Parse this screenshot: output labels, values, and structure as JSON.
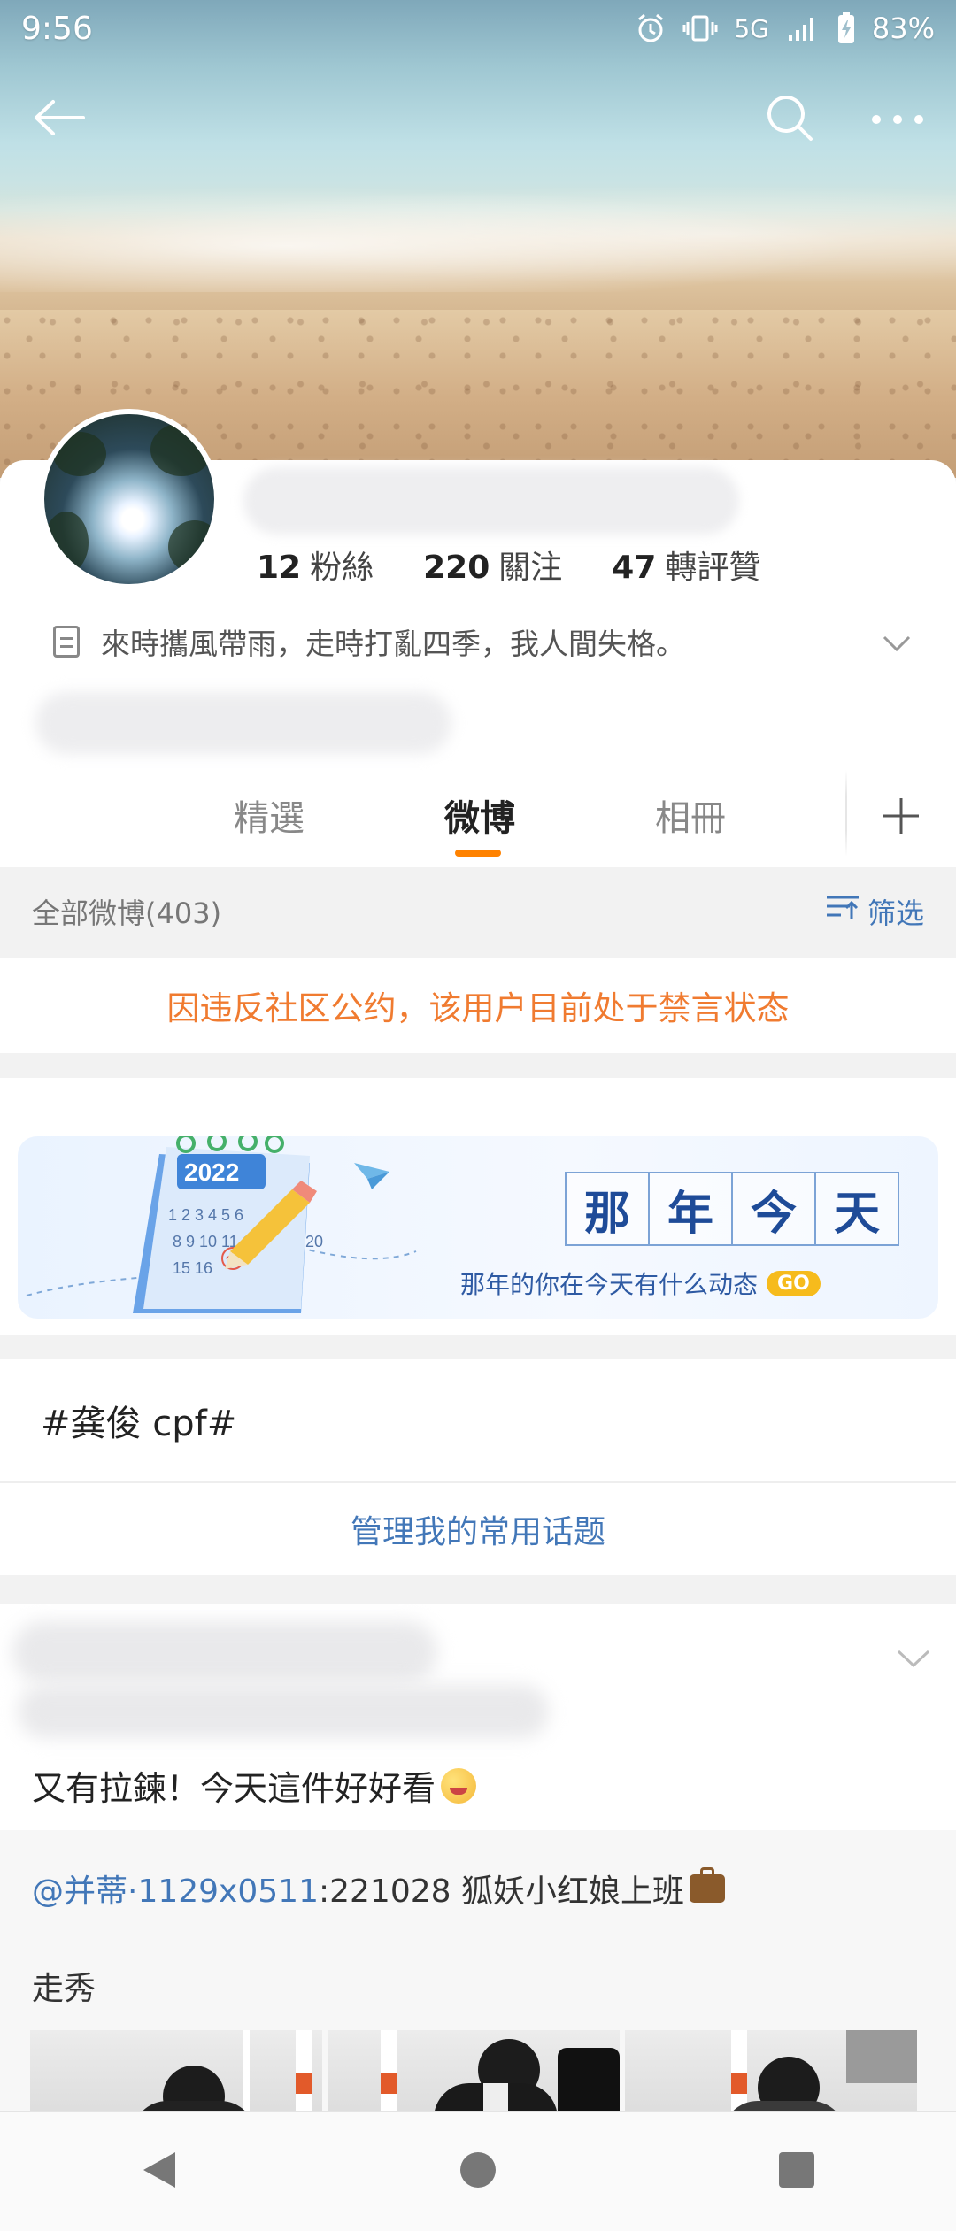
{
  "status_bar": {
    "time": "9:56",
    "network": "5G",
    "battery": "83%",
    "icons": [
      "alarm-icon",
      "vibrate-icon",
      "signal-icon",
      "battery-icon"
    ]
  },
  "top_bar": {
    "icons": [
      "back-arrow-icon",
      "search-icon",
      "more-icon"
    ]
  },
  "profile": {
    "stats": [
      {
        "value": "12",
        "label": "粉絲"
      },
      {
        "value": "220",
        "label": "關注"
      },
      {
        "value": "47",
        "label": "轉評贊"
      }
    ],
    "bio": "來時攜風帶雨，走時打亂四季，我人間失格。"
  },
  "tabs": [
    {
      "label": "精選",
      "active": false
    },
    {
      "label": "微博",
      "active": true
    },
    {
      "label": "相冊",
      "active": false
    }
  ],
  "feed_header": {
    "all_posts": "全部微博(403)",
    "filter": "筛选"
  },
  "notice": "因违反社区公约，该用户目前处于禁言状态",
  "memories_banner": {
    "title_chars": [
      "那",
      "年",
      "今",
      "天"
    ],
    "subtitle": "那年的你在今天有什么动态",
    "go": "GO",
    "calendar_year": "2022",
    "calendar_days": "1 2 3 4 5 6",
    "calendar_days2": "8 9 10 11 12",
    "calendar_days3": "15 16",
    "calendar_day_extra": "20",
    "today_mark": "今"
  },
  "topic": {
    "text": "#龚俊 cpf#",
    "manage": "管理我的常用话题"
  },
  "post": {
    "text": "又有拉鍊！今天這件好好看",
    "repost_at": "@并蒂·1129x0511",
    "repost_text": ":221028 狐妖小红娘上班",
    "repost_sub": "走秀"
  },
  "colors": {
    "accent": "#ff8200",
    "link": "#4277b8",
    "notice": "#f07b30",
    "memory_title": "#1e4b98",
    "go_badge": "#f6bb1c"
  }
}
